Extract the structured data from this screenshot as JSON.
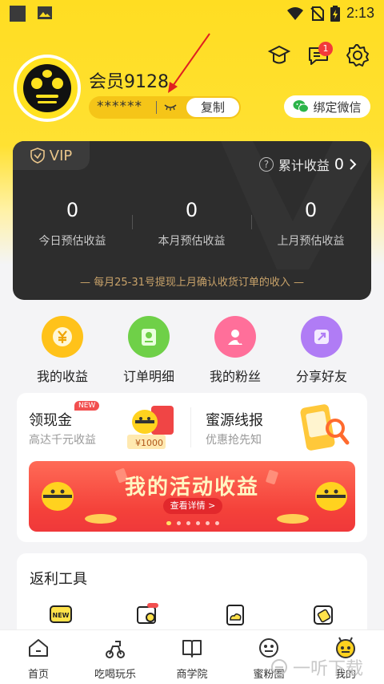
{
  "status_bar": {
    "time": "2:13"
  },
  "profile": {
    "username": "会员9128",
    "masked_password": "******",
    "copy_label": "复制",
    "bind_wechat_label": "绑定微信",
    "message_badge": "1"
  },
  "vip": {
    "tag": "VIP",
    "cumulative_label": "累计收益",
    "cumulative_value": "0",
    "stats": [
      {
        "value": "0",
        "label": "今日预估收益"
      },
      {
        "value": "0",
        "label": "本月预估收益"
      },
      {
        "value": "0",
        "label": "上月预估收益"
      }
    ],
    "note": "— 每月25-31号提现上月确认收货订单的收入 —"
  },
  "quick_actions": [
    {
      "label": "我的收益",
      "icon": "yuan-coin-icon",
      "color": "#ffc21a"
    },
    {
      "label": "订单明细",
      "icon": "order-detail-icon",
      "color": "#6fd048"
    },
    {
      "label": "我的粉丝",
      "icon": "fans-user-icon",
      "color": "#ff6f9a"
    },
    {
      "label": "分享好友",
      "icon": "share-icon",
      "color": "#b07cf5"
    }
  ],
  "promo": {
    "left": {
      "title": "领现金",
      "badge": "NEW",
      "subtitle": "高达千元收益",
      "amount": "¥1000"
    },
    "right": {
      "title": "蜜源线报",
      "subtitle": "优惠抢先知"
    },
    "banner": {
      "title": "我的活动收益",
      "button": "查看详情 >"
    }
  },
  "tools": {
    "title": "返利工具",
    "items": [
      {
        "icon": "news-icon",
        "badge": ""
      },
      {
        "icon": "search-deal-icon",
        "badge": "new"
      },
      {
        "icon": "cloud-doc-icon",
        "badge": ""
      },
      {
        "icon": "link-copy-icon",
        "badge": ""
      }
    ]
  },
  "bottom_nav": [
    {
      "label": "首页",
      "icon": "home-icon",
      "active": false
    },
    {
      "label": "吃喝玩乐",
      "icon": "scooter-icon",
      "active": false
    },
    {
      "label": "商学院",
      "icon": "book-icon",
      "active": false
    },
    {
      "label": "蜜粉圈",
      "icon": "bee-circle-icon",
      "active": false
    },
    {
      "label": "我的",
      "icon": "bee-profile-icon",
      "active": true
    }
  ],
  "watermark": "一听下载",
  "colors": {
    "brand_yellow": "#ffdd22",
    "vip_gold": "#e9c58a",
    "banner_red": "#f4413a"
  }
}
